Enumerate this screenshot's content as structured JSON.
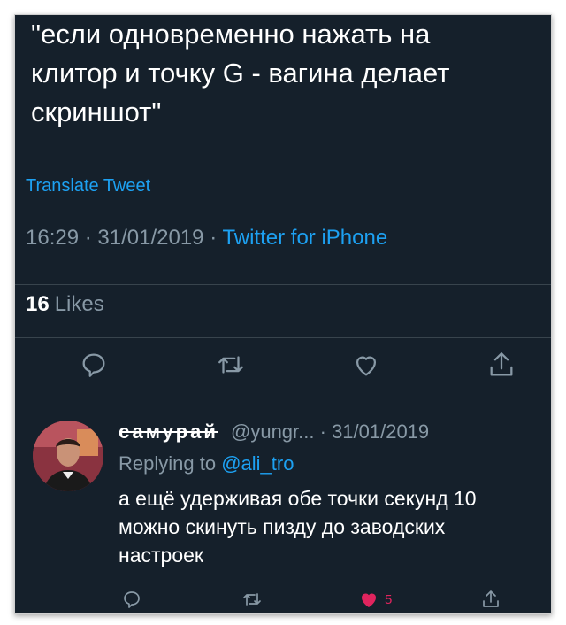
{
  "tweet": {
    "text": "\"если одновременно нажать на\nклитор и точку G - вагина делает\nскриншот\"",
    "translate_label": "Translate Tweet",
    "time": "16:29",
    "date": "31/01/2019",
    "dot": "·",
    "source": "Twitter for iPhone",
    "likes_count": "16",
    "likes_label": "Likes"
  },
  "reply": {
    "display_name": "самурай",
    "handle": "@yungr...",
    "date": "· 31/01/2019",
    "replying_prefix": "Replying to",
    "replying_to": "@ali_tro",
    "text": "а ещё удерживая обе точки секунд 10\nможно скинуть пизду до заводских\nнастроек",
    "like_count": "5"
  },
  "colors": {
    "background": "#15202b",
    "accent": "#1da1f2",
    "muted": "#8899a6",
    "like": "#e0245e"
  },
  "icons": [
    "reply-icon",
    "retweet-icon",
    "like-icon",
    "share-icon"
  ]
}
